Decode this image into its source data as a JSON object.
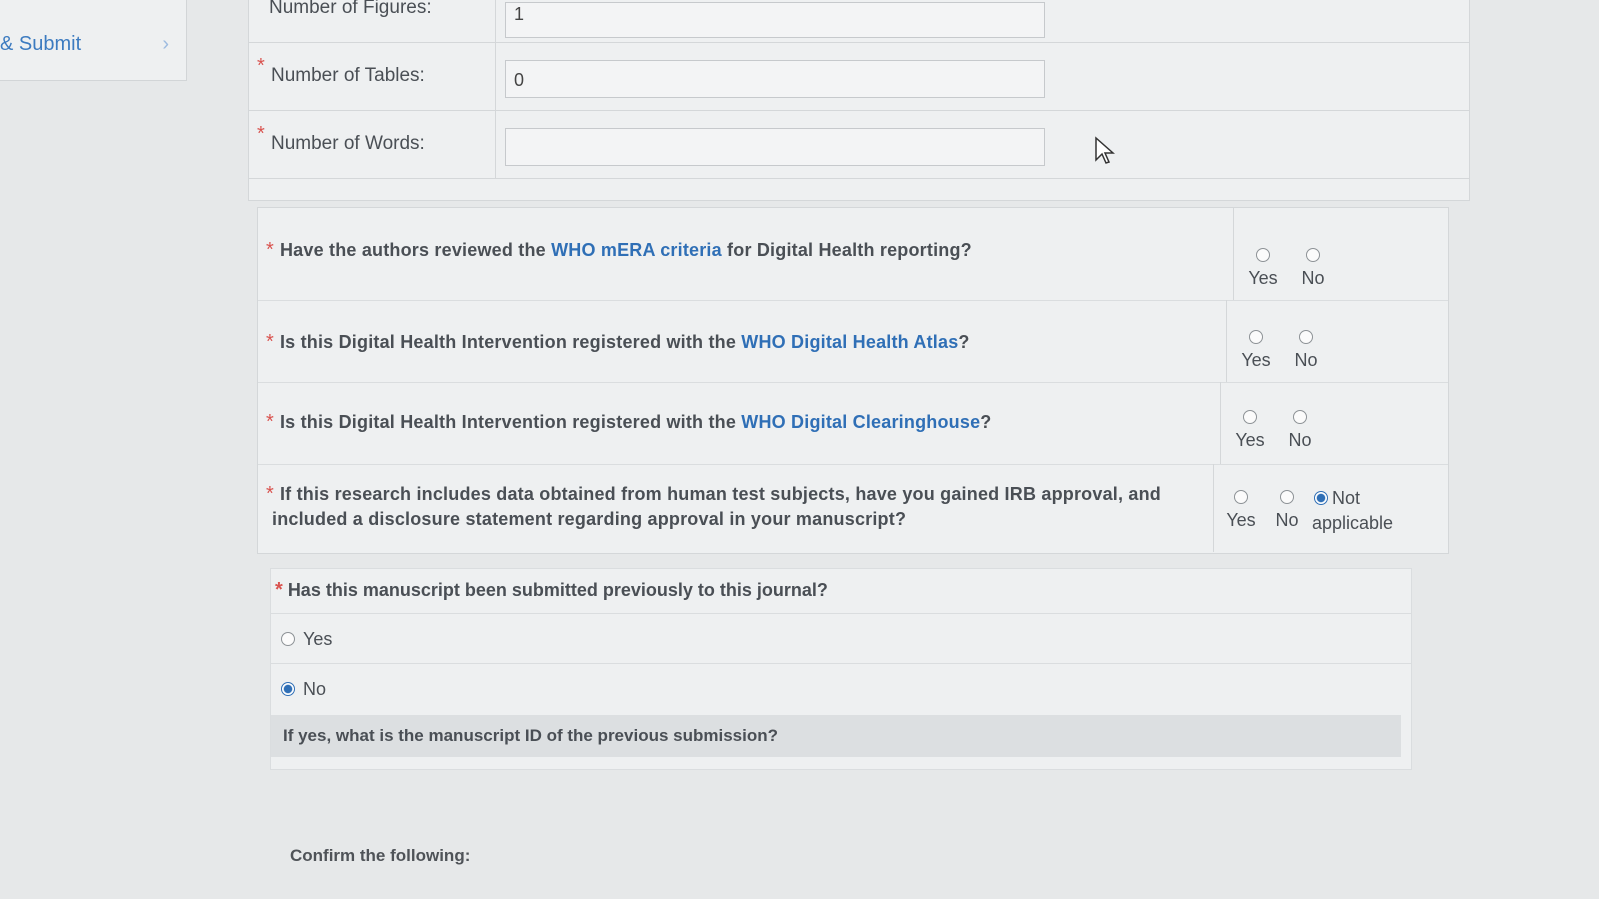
{
  "sidebar": {
    "nav_label": "& Submit",
    "chevron": "›"
  },
  "details": {
    "figures": {
      "label": "Number of Figures:",
      "value": "1"
    },
    "tables": {
      "label": "Number of Tables:",
      "value": "0",
      "required": "*"
    },
    "words": {
      "label": "Number of Words:",
      "value": "",
      "required": "*"
    }
  },
  "questions": [
    {
      "pre": "Have the authors reviewed the ",
      "link": "WHO mERA criteria",
      "post": " for Digital Health reporting?",
      "options": [
        "Yes",
        "No"
      ],
      "selected": null
    },
    {
      "pre": "Is this Digital Health Intervention registered with the ",
      "link": "WHO Digital Health Atlas",
      "post": "?",
      "options": [
        "Yes",
        "No"
      ],
      "selected": null
    },
    {
      "pre": "Is this Digital Health Intervention registered with the ",
      "link": "WHO Digital Clearinghouse",
      "post": "?",
      "options": [
        "Yes",
        "No"
      ],
      "selected": null
    },
    {
      "line1": "If this research includes data obtained from human test subjects, have you gained IRB approval, and",
      "line2": "included a disclosure statement regarding approval in your manuscript?",
      "options": [
        "Yes",
        "No",
        "Not applicable"
      ],
      "option3_line1": "Not",
      "option3_line2": "applicable",
      "selected": "Not applicable"
    }
  ],
  "required_mark": "*",
  "previous_submission": {
    "question": "Has this manuscript been submitted previously to this journal?",
    "options": [
      "Yes",
      "No"
    ],
    "selected": "No",
    "followup": "If yes, what is the manuscript ID of the previous submission?"
  },
  "confirm_label": "Confirm the following:",
  "icons": {
    "cursor": "mouse-pointer-icon",
    "chevron": "chevron-right-icon"
  },
  "colors": {
    "link": "#2f6fb6",
    "required": "#d9534f",
    "nav": "#3c7bc0"
  }
}
